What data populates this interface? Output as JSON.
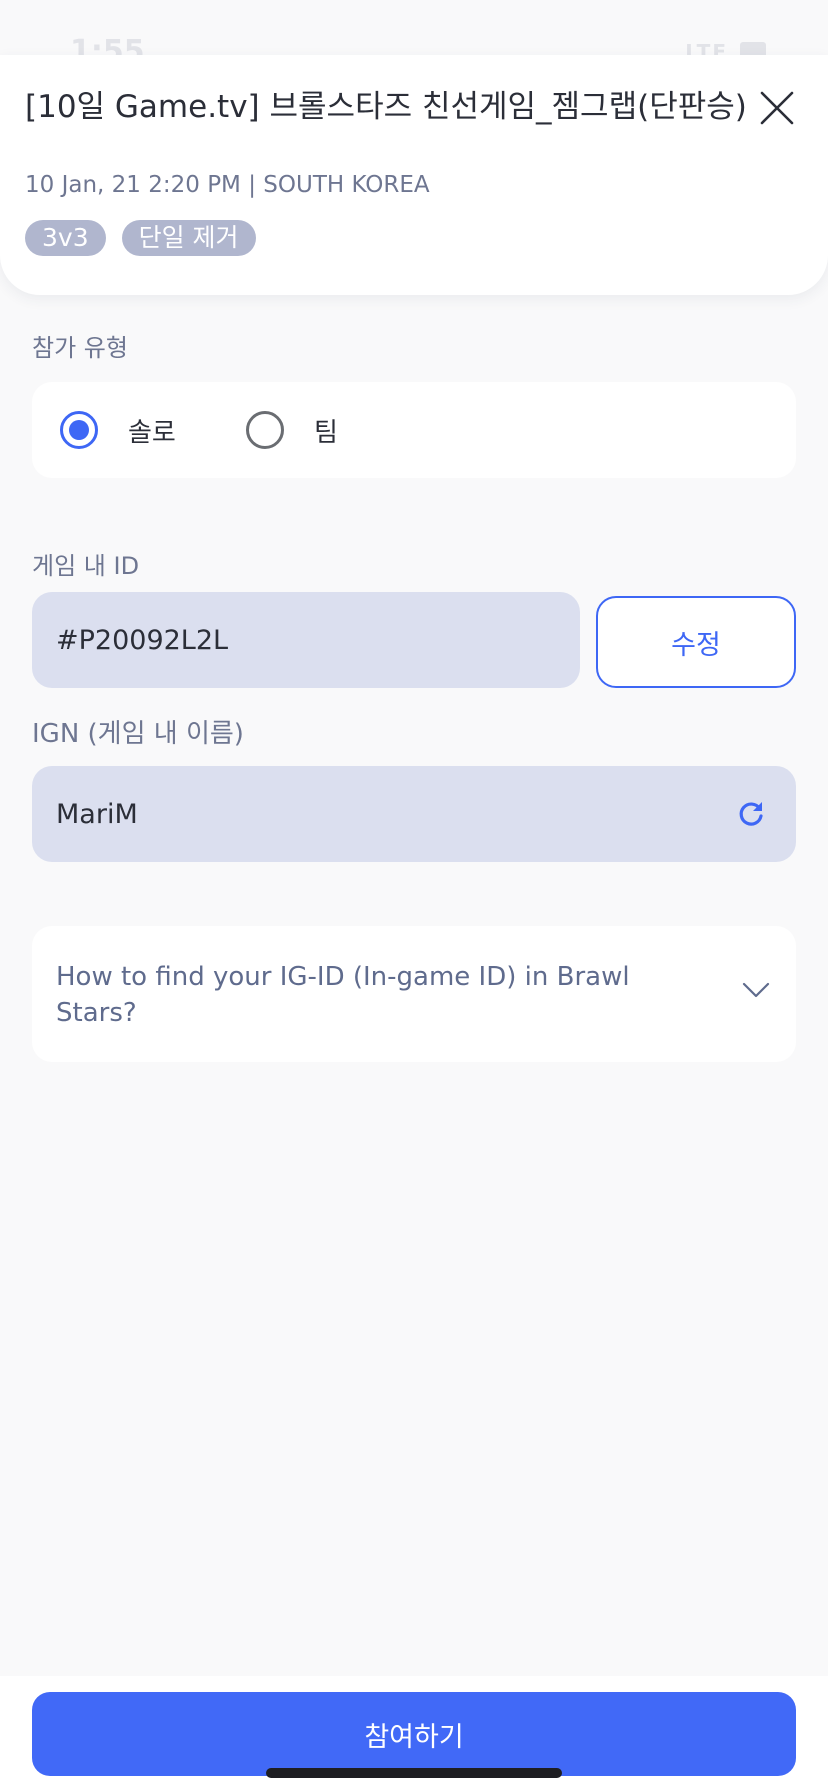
{
  "status_bar": {
    "time": "1:55",
    "network": "LTE"
  },
  "header": {
    "title": "[10일 Game.tv] 브롤스타즈 친선게임_젬그랩(단판승)",
    "meta": "10 Jan, 21 2:20 PM | SOUTH KOREA",
    "tags": [
      "3v3",
      "단일 제거"
    ],
    "close_icon": "close-icon"
  },
  "participation": {
    "label": "참가 유형",
    "options": [
      {
        "label": "솔로",
        "selected": true
      },
      {
        "label": "팀",
        "selected": false
      }
    ]
  },
  "game_id": {
    "label": "게임 내 ID",
    "value": "#P20092L2L",
    "edit_label": "수정"
  },
  "ign": {
    "label": "IGN (게임 내 이름)",
    "value": "MariM",
    "refresh_icon": "refresh-icon"
  },
  "help": {
    "text": "How to find your IG-ID (In-game ID) in Brawl Stars?",
    "chevron_icon": "chevron-down-icon"
  },
  "footer": {
    "join_label": "참여하기"
  },
  "colors": {
    "accent": "#4169f7",
    "background": "#f9f9fa",
    "input_fill": "#dbdfef",
    "tag_fill": "#b0b6ce",
    "muted_text": "#6e7691"
  }
}
